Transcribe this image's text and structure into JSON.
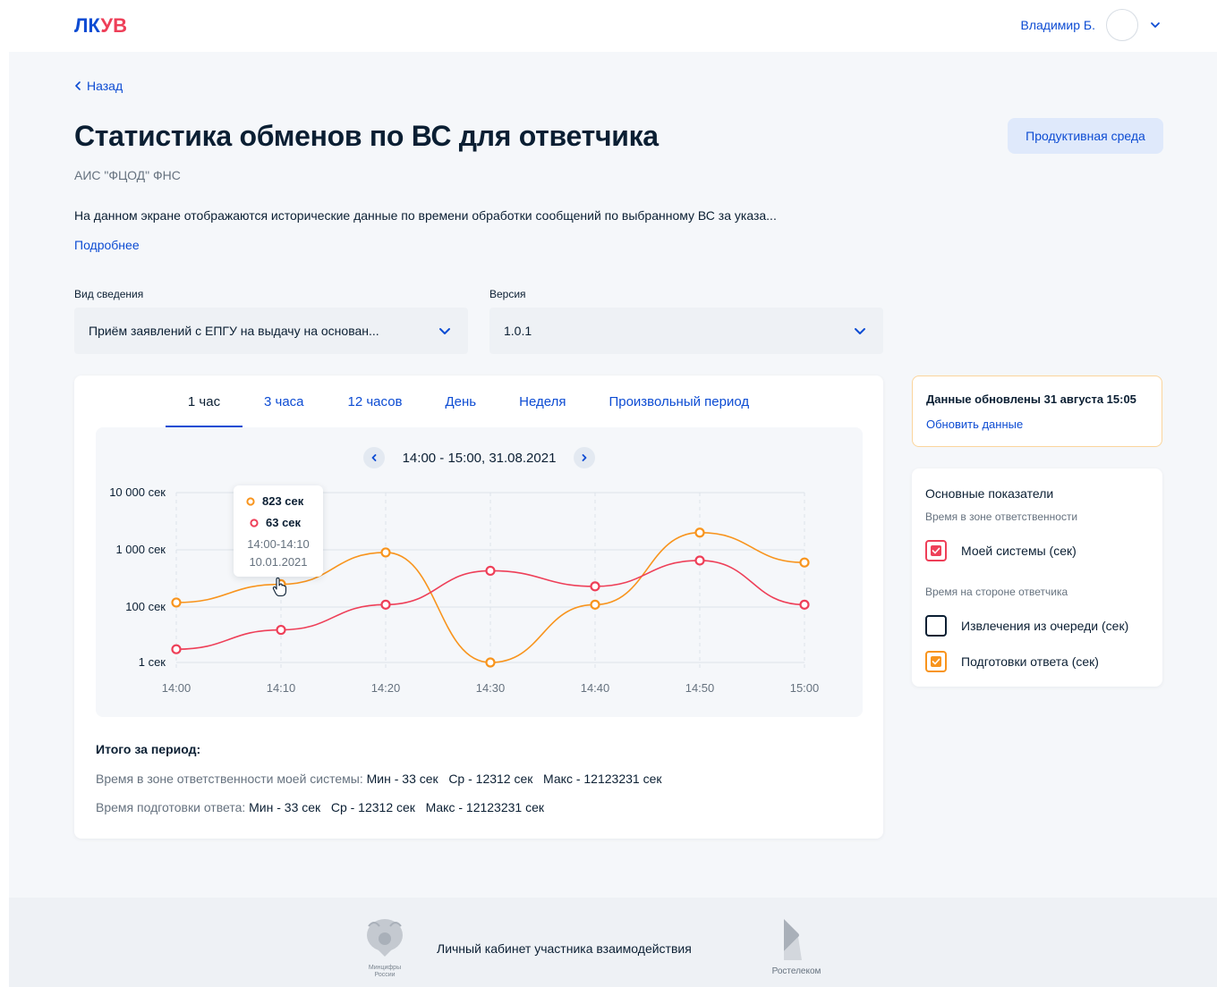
{
  "header": {
    "logo_part1": "ЛК",
    "logo_part2": "УВ",
    "user_name": "Владимир Б."
  },
  "page": {
    "back_label": "Назад",
    "title": "Статистика обменов по ВС для ответчика",
    "env_badge": "Продуктивная среда",
    "subtitle": "АИС \"ФЦОД\" ФНС",
    "description": "На данном экране отображаются исторические данные по времени обработки сообщений по выбранному ВС за указа...",
    "more_link": "Подробнее"
  },
  "filters": {
    "kind_label": "Вид сведения",
    "kind_value": "Приём заявлений с ЕПГУ на выдачу на основан...",
    "version_label": "Версия",
    "version_value": "1.0.1"
  },
  "tabs": [
    {
      "label": "1 час",
      "active": true
    },
    {
      "label": "3 часа",
      "active": false
    },
    {
      "label": "12 часов",
      "active": false
    },
    {
      "label": "День",
      "active": false
    },
    {
      "label": "Неделя",
      "active": false
    },
    {
      "label": "Произвольный период",
      "active": false
    }
  ],
  "period_label": "14:00 - 15:00, 31.08.2021",
  "tooltip": {
    "orange_value": "823 сек",
    "red_value": "63 сек",
    "range": "14:00-14:10",
    "date": "10.01.2021"
  },
  "chart_data": {
    "type": "line",
    "x": [
      "14:00",
      "14:10",
      "14:20",
      "14:30",
      "14:40",
      "14:50",
      "15:00"
    ],
    "y_ticks": [
      "10 000 сек",
      "1 000 сек",
      "100 сек",
      "1 сек"
    ],
    "y_tick_values": [
      10000,
      1000,
      100,
      1
    ],
    "y_scale": "log",
    "grid": true,
    "series": [
      {
        "color": "#f8941d",
        "values": [
          120,
          250,
          900,
          1,
          110,
          2000,
          600
        ]
      },
      {
        "color": "#ee3f58",
        "values": [
          3,
          15,
          110,
          430,
          230,
          650,
          110
        ]
      }
    ]
  },
  "totals": {
    "title": "Итого за период:",
    "line1_label": "Время в зоне ответственности моей системы: ",
    "line1_values": "Мин - 33 сек   Ср - 12312 сек   Макс - 12123231 сек",
    "line2_label": "Время подготовки ответа: ",
    "line2_values": "Мин - 33 сек   Ср - 12312 сек   Макс - 12123231 сек"
  },
  "update": {
    "title": "Данные обновлены 31 августа 15:05",
    "link": "Обновить данные"
  },
  "legend": {
    "heading": "Основные показатели",
    "group1": "Время в зоне ответственности",
    "item1": "Моей системы (сек)",
    "group2": "Время на стороне ответчика",
    "item2": "Извлечения из очереди (сек)",
    "item3": "Подготовки ответа (сек)",
    "item1_color": "#ee3f58",
    "item2_color": "#0b1f33",
    "item3_color": "#f8941d"
  },
  "footer": {
    "emblem_caption_1": "Минцифры",
    "emblem_caption_2": "России",
    "text": "Личный кабинет участника взаимодействия",
    "partner": "Ростелеком"
  }
}
